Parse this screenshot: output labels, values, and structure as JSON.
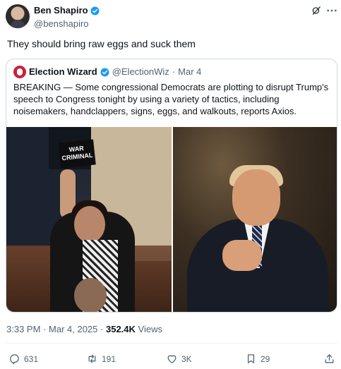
{
  "author": {
    "name": "Ben Shapiro",
    "handle": "@benshapiro"
  },
  "post": {
    "text": "They should bring raw eggs and suck them"
  },
  "quote": {
    "name": "Election Wizard",
    "handle": "@ElectionWiz",
    "separator": "·",
    "date": "Mar 4",
    "text": "BREAKING — Some congressional Democrats are plotting to disrupt Trump's speech to Congress tonight by using a variety of tactics, including noisemakers, handclappers, signs, eggs, and walkouts, reports Axios.",
    "image_left_sign": "WAR CRIMINAL"
  },
  "meta": {
    "time": "3:33 PM",
    "separator": "·",
    "date": "Mar 4, 2025",
    "views_count": "352.4K",
    "views_label": "Views"
  },
  "actions": {
    "replies": "631",
    "reposts": "191",
    "likes": "3K",
    "bookmarks": "29"
  },
  "colors": {
    "verified": "#1d9bf0",
    "muted": "#536471",
    "text": "#0f1419",
    "border": "#cfd9de"
  }
}
